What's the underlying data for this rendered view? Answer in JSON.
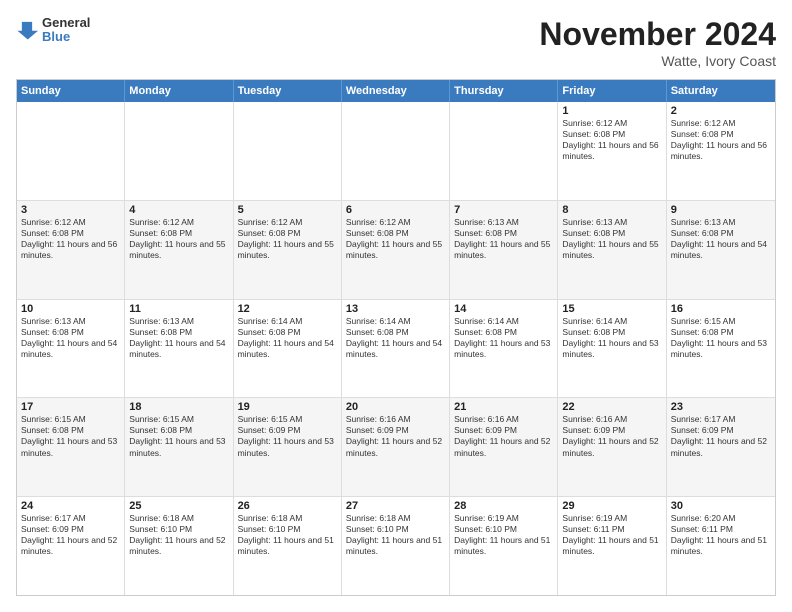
{
  "header": {
    "logo": {
      "general": "General",
      "blue": "Blue"
    },
    "title": "November 2024",
    "location": "Watte, Ivory Coast"
  },
  "days_of_week": [
    "Sunday",
    "Monday",
    "Tuesday",
    "Wednesday",
    "Thursday",
    "Friday",
    "Saturday"
  ],
  "weeks": [
    {
      "alt": false,
      "cells": [
        {
          "day": "",
          "info": ""
        },
        {
          "day": "",
          "info": ""
        },
        {
          "day": "",
          "info": ""
        },
        {
          "day": "",
          "info": ""
        },
        {
          "day": "",
          "info": ""
        },
        {
          "day": "1",
          "info": "Sunrise: 6:12 AM\nSunset: 6:08 PM\nDaylight: 11 hours and 56 minutes."
        },
        {
          "day": "2",
          "info": "Sunrise: 6:12 AM\nSunset: 6:08 PM\nDaylight: 11 hours and 56 minutes."
        }
      ]
    },
    {
      "alt": true,
      "cells": [
        {
          "day": "3",
          "info": "Sunrise: 6:12 AM\nSunset: 6:08 PM\nDaylight: 11 hours and 56 minutes."
        },
        {
          "day": "4",
          "info": "Sunrise: 6:12 AM\nSunset: 6:08 PM\nDaylight: 11 hours and 55 minutes."
        },
        {
          "day": "5",
          "info": "Sunrise: 6:12 AM\nSunset: 6:08 PM\nDaylight: 11 hours and 55 minutes."
        },
        {
          "day": "6",
          "info": "Sunrise: 6:12 AM\nSunset: 6:08 PM\nDaylight: 11 hours and 55 minutes."
        },
        {
          "day": "7",
          "info": "Sunrise: 6:13 AM\nSunset: 6:08 PM\nDaylight: 11 hours and 55 minutes."
        },
        {
          "day": "8",
          "info": "Sunrise: 6:13 AM\nSunset: 6:08 PM\nDaylight: 11 hours and 55 minutes."
        },
        {
          "day": "9",
          "info": "Sunrise: 6:13 AM\nSunset: 6:08 PM\nDaylight: 11 hours and 54 minutes."
        }
      ]
    },
    {
      "alt": false,
      "cells": [
        {
          "day": "10",
          "info": "Sunrise: 6:13 AM\nSunset: 6:08 PM\nDaylight: 11 hours and 54 minutes."
        },
        {
          "day": "11",
          "info": "Sunrise: 6:13 AM\nSunset: 6:08 PM\nDaylight: 11 hours and 54 minutes."
        },
        {
          "day": "12",
          "info": "Sunrise: 6:14 AM\nSunset: 6:08 PM\nDaylight: 11 hours and 54 minutes."
        },
        {
          "day": "13",
          "info": "Sunrise: 6:14 AM\nSunset: 6:08 PM\nDaylight: 11 hours and 54 minutes."
        },
        {
          "day": "14",
          "info": "Sunrise: 6:14 AM\nSunset: 6:08 PM\nDaylight: 11 hours and 53 minutes."
        },
        {
          "day": "15",
          "info": "Sunrise: 6:14 AM\nSunset: 6:08 PM\nDaylight: 11 hours and 53 minutes."
        },
        {
          "day": "16",
          "info": "Sunrise: 6:15 AM\nSunset: 6:08 PM\nDaylight: 11 hours and 53 minutes."
        }
      ]
    },
    {
      "alt": true,
      "cells": [
        {
          "day": "17",
          "info": "Sunrise: 6:15 AM\nSunset: 6:08 PM\nDaylight: 11 hours and 53 minutes."
        },
        {
          "day": "18",
          "info": "Sunrise: 6:15 AM\nSunset: 6:08 PM\nDaylight: 11 hours and 53 minutes."
        },
        {
          "day": "19",
          "info": "Sunrise: 6:15 AM\nSunset: 6:09 PM\nDaylight: 11 hours and 53 minutes."
        },
        {
          "day": "20",
          "info": "Sunrise: 6:16 AM\nSunset: 6:09 PM\nDaylight: 11 hours and 52 minutes."
        },
        {
          "day": "21",
          "info": "Sunrise: 6:16 AM\nSunset: 6:09 PM\nDaylight: 11 hours and 52 minutes."
        },
        {
          "day": "22",
          "info": "Sunrise: 6:16 AM\nSunset: 6:09 PM\nDaylight: 11 hours and 52 minutes."
        },
        {
          "day": "23",
          "info": "Sunrise: 6:17 AM\nSunset: 6:09 PM\nDaylight: 11 hours and 52 minutes."
        }
      ]
    },
    {
      "alt": false,
      "cells": [
        {
          "day": "24",
          "info": "Sunrise: 6:17 AM\nSunset: 6:09 PM\nDaylight: 11 hours and 52 minutes."
        },
        {
          "day": "25",
          "info": "Sunrise: 6:18 AM\nSunset: 6:10 PM\nDaylight: 11 hours and 52 minutes."
        },
        {
          "day": "26",
          "info": "Sunrise: 6:18 AM\nSunset: 6:10 PM\nDaylight: 11 hours and 51 minutes."
        },
        {
          "day": "27",
          "info": "Sunrise: 6:18 AM\nSunset: 6:10 PM\nDaylight: 11 hours and 51 minutes."
        },
        {
          "day": "28",
          "info": "Sunrise: 6:19 AM\nSunset: 6:10 PM\nDaylight: 11 hours and 51 minutes."
        },
        {
          "day": "29",
          "info": "Sunrise: 6:19 AM\nSunset: 6:11 PM\nDaylight: 11 hours and 51 minutes."
        },
        {
          "day": "30",
          "info": "Sunrise: 6:20 AM\nSunset: 6:11 PM\nDaylight: 11 hours and 51 minutes."
        }
      ]
    }
  ]
}
